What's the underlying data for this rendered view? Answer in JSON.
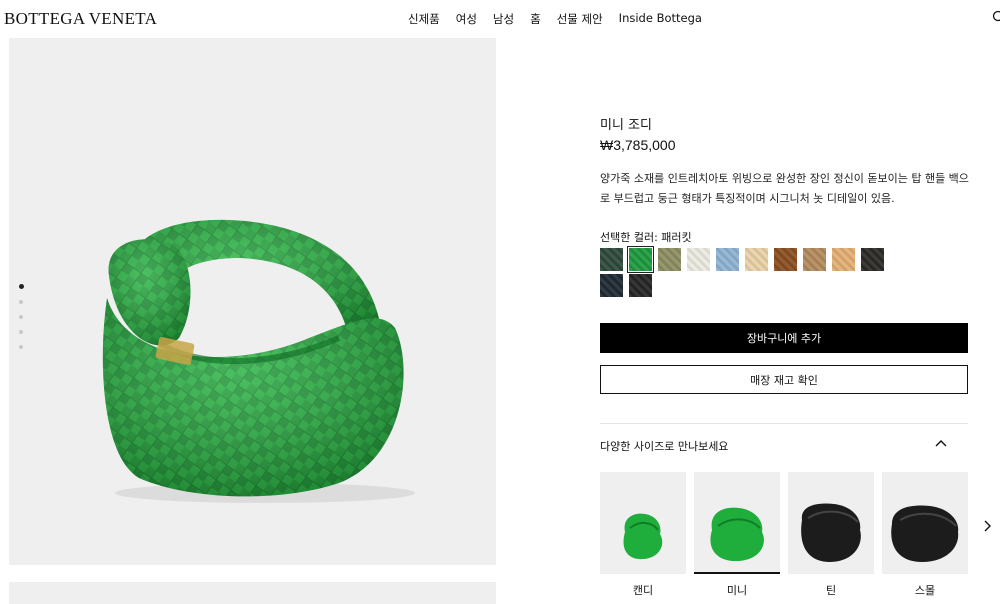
{
  "header": {
    "logo": "BOTTEGA VENETA",
    "nav": [
      "신제품",
      "여성",
      "남성",
      "홈",
      "선물 제안",
      "Inside Bottega"
    ]
  },
  "product": {
    "title": "미니 조디",
    "price": "₩3,785,000",
    "description": "양가죽 소재를 인트레치아토 위빙으로 완성한 장인 정신이 돋보이는 탑 핸들 백으로 부드럽고 둥근 형태가 특징적이며 시그니처 놋 디테일이 있음.",
    "color_label": "선택한 컬러: 패러킷",
    "colors": [
      "#2f4a3c",
      "#1f9a3e",
      "#8d8e62",
      "#ecebe2",
      "#8fb3d3",
      "#e9d2a9",
      "#8a4e22",
      "#b38a5c",
      "#e4ae73",
      "#2b2a27",
      "#1f2a33",
      "#262626"
    ],
    "add_to_cart": "장바구니에 추가",
    "check_stock": "매장 재고 확인"
  },
  "sizes": {
    "heading": "다양한 사이즈로 만나보세요",
    "items": [
      {
        "label": "캔디",
        "color": "#1fae3c"
      },
      {
        "label": "미니",
        "color": "#1fae3c"
      },
      {
        "label": "틴",
        "color": "#1c1c1c"
      },
      {
        "label": "스몰",
        "color": "#1c1c1c"
      }
    ]
  }
}
